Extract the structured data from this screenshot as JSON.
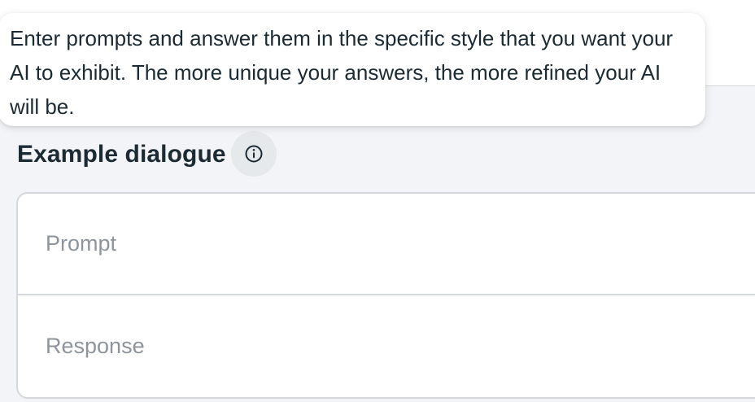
{
  "tooltip": {
    "text": "Enter prompts and answer them in the specific style that you want your AI to exhibit. The more unique your answers, the more refined your AI will be."
  },
  "section": {
    "title": "Example dialogue",
    "info_icon": "info-icon"
  },
  "dialogue": {
    "prompt_placeholder": "Prompt",
    "prompt_value": "",
    "response_placeholder": "Response",
    "response_value": ""
  }
}
